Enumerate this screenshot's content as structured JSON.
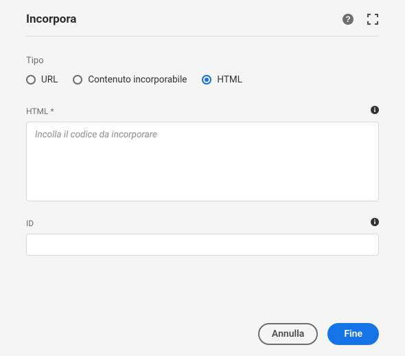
{
  "header": {
    "title": "Incorpora"
  },
  "type_section": {
    "label": "Tipo",
    "options": {
      "url": {
        "label": "URL",
        "selected": false
      },
      "embeddable": {
        "label": "Contenuto incorporabile",
        "selected": false
      },
      "html": {
        "label": "HTML",
        "selected": true
      }
    }
  },
  "fields": {
    "html": {
      "label": "HTML *",
      "placeholder": "Incolla il codice da incorporare",
      "value": ""
    },
    "id": {
      "label": "ID",
      "value": ""
    }
  },
  "footer": {
    "cancel": "Annulla",
    "done": "Fine"
  }
}
